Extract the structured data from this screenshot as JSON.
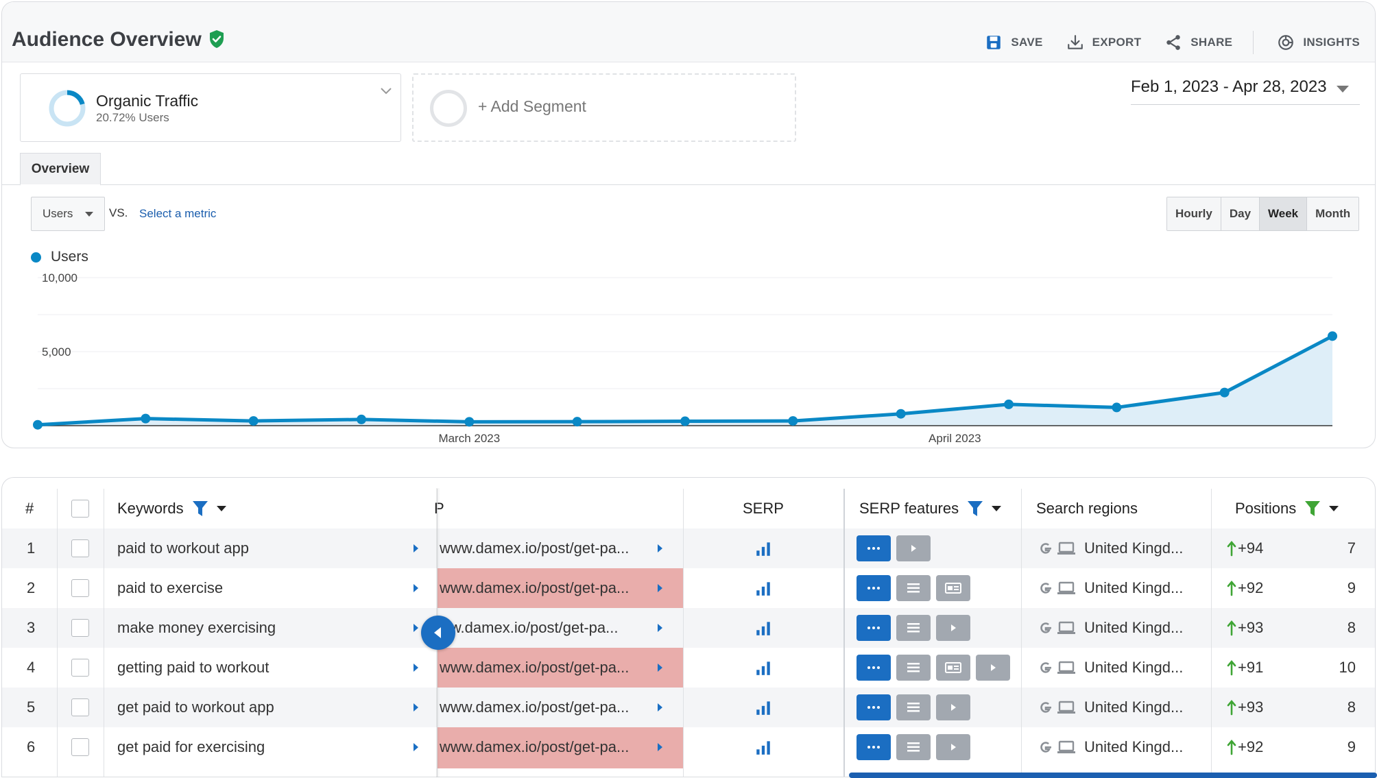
{
  "header": {
    "title": "Audience Overview",
    "toolbar": [
      {
        "label": "SAVE",
        "icon": "save-icon"
      },
      {
        "label": "EXPORT",
        "icon": "export-icon"
      },
      {
        "label": "SHARE",
        "icon": "share-icon"
      },
      {
        "label": "INSIGHTS",
        "icon": "insights-icon"
      }
    ]
  },
  "segments": {
    "active": {
      "name": "Organic Traffic",
      "sub": "20.72% Users",
      "share": 0.2072
    },
    "add_label": "+ Add Segment"
  },
  "date_range": "Feb 1, 2023 - Apr 28, 2023",
  "tabs": {
    "overview": "Overview"
  },
  "metric": {
    "selected": "Users",
    "vs": "VS.",
    "select_metric": "Select a metric"
  },
  "granularity": {
    "options": [
      "Hourly",
      "Day",
      "Week",
      "Month"
    ],
    "active": "Week"
  },
  "chart_data": {
    "type": "line",
    "series": [
      {
        "name": "Users",
        "values": [
          60,
          480,
          320,
          420,
          260,
          270,
          300,
          320,
          800,
          1440,
          1230,
          2240,
          6050
        ]
      }
    ],
    "x_labels": [
      "March 2023",
      "April 2023"
    ],
    "y_ticks": [
      "10,000",
      "5,000"
    ],
    "ylim": [
      0,
      10000
    ],
    "legend": "top-left",
    "grid": true,
    "color": "#0a88c5",
    "area_color": "#deeef8"
  },
  "table": {
    "headers": {
      "num": "#",
      "keywords": "Keywords",
      "url": "P",
      "serp": "SERP",
      "features": "SERP features",
      "regions": "Search regions",
      "positions": "Positions"
    },
    "rows": [
      {
        "num": "1",
        "keyword": "paid to workout app",
        "url": "www.damex.io/post/get-pa...",
        "features": [
          "more",
          "video"
        ],
        "region": "United Kingd...",
        "change": "+94",
        "position": "7"
      },
      {
        "num": "2",
        "keyword": "paid to exercise",
        "url": "www.damex.io/post/get-pa...",
        "features": [
          "more",
          "list",
          "card"
        ],
        "region": "United Kingd...",
        "change": "+92",
        "position": "9"
      },
      {
        "num": "3",
        "keyword": "make money exercising",
        "url": "ww.damex.io/post/get-pa...",
        "features": [
          "more",
          "list",
          "video"
        ],
        "region": "United Kingd...",
        "change": "+93",
        "position": "8"
      },
      {
        "num": "4",
        "keyword": "getting paid to workout",
        "url": "www.damex.io/post/get-pa...",
        "features": [
          "more",
          "list",
          "card",
          "video"
        ],
        "region": "United Kingd...",
        "change": "+91",
        "position": "10"
      },
      {
        "num": "5",
        "keyword": "get paid to workout app",
        "url": "www.damex.io/post/get-pa...",
        "features": [
          "more",
          "list",
          "video"
        ],
        "region": "United Kingd...",
        "change": "+93",
        "position": "8"
      },
      {
        "num": "6",
        "keyword": "get paid for exercising",
        "url": "www.damex.io/post/get-pa...",
        "features": [
          "more",
          "list",
          "video"
        ],
        "region": "United Kingd...",
        "change": "+92",
        "position": "9"
      }
    ]
  },
  "colors": {
    "accent": "#1b6ec2",
    "link": "#1a5dad",
    "verified": "#1e9e52",
    "filter_green": "#3fa535",
    "url_highlight": "#e9adab"
  }
}
